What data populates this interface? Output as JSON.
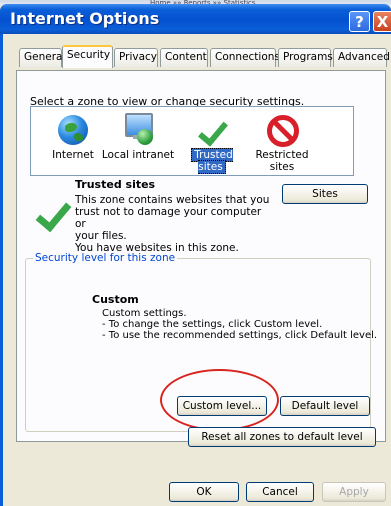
{
  "background": {
    "strip_text": "Home  »»  Reports  »»  Statistics"
  },
  "window": {
    "title": "Internet Options",
    "help_label": "?",
    "close_label": "X"
  },
  "tabs": [
    {
      "label": "General"
    },
    {
      "label": "Security"
    },
    {
      "label": "Privacy"
    },
    {
      "label": "Content"
    },
    {
      "label": "Connections"
    },
    {
      "label": "Programs"
    },
    {
      "label": "Advanced"
    }
  ],
  "security": {
    "zone_prompt": "Select a zone to view or change security settings.",
    "zones": [
      {
        "label": "Internet",
        "icon": "globe-icon"
      },
      {
        "label": "Local intranet",
        "icon": "intranet-icon"
      },
      {
        "label": "Trusted sites",
        "icon": "checkmark-icon",
        "selected": true
      },
      {
        "label": "Restricted sites",
        "icon": "no-entry-icon"
      }
    ],
    "zone_title": "Trusted sites",
    "zone_desc_1": "This zone contains websites that you",
    "zone_desc_2": "trust not to damage your computer or",
    "zone_desc_3": "your files.",
    "zone_desc_4": "You have websites in this zone.",
    "sites_button": "Sites",
    "level_group_title": "Security level for this zone",
    "level_title": "Custom",
    "level_desc_1": "Custom settings.",
    "level_desc_2": "- To change the settings, click Custom level.",
    "level_desc_3": "- To use the recommended settings, click Default level.",
    "custom_level_button": "Custom level...",
    "default_level_button": "Default level",
    "reset_button": "Reset all zones to default level"
  },
  "footer": {
    "ok": "OK",
    "cancel": "Cancel",
    "apply": "Apply"
  },
  "colors": {
    "titlebar": "#0551d0",
    "annotation_ellipse": "#d8251f",
    "selected_zone": "#316ac5"
  }
}
